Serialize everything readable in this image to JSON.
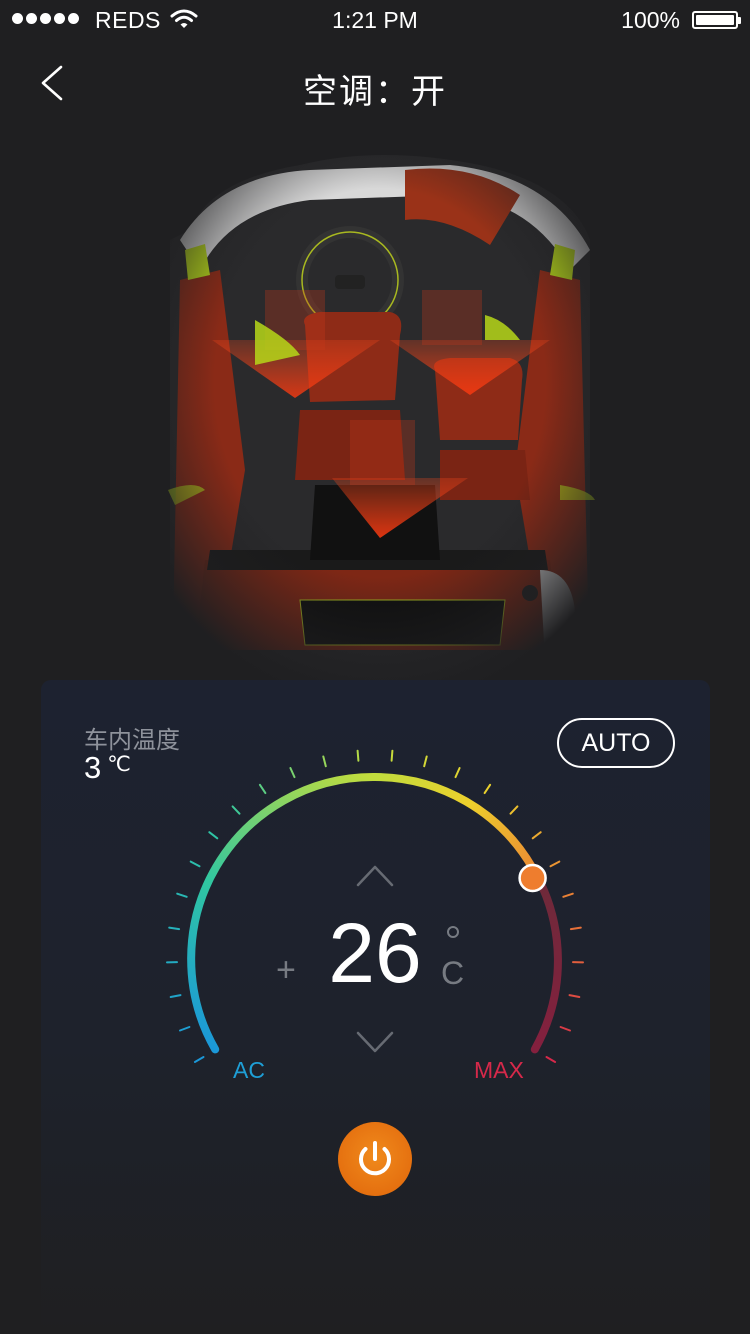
{
  "status_bar": {
    "carrier": "REDS",
    "time": "1:21 PM",
    "battery_percent": "100%"
  },
  "nav": {
    "title": "空调：开"
  },
  "panel": {
    "inner_temp_label": "车内温度",
    "inner_temp_value": "3",
    "inner_temp_unit": "℃",
    "auto_label": "AUTO",
    "target_temp": "26",
    "target_unit": "C",
    "plus_label": "+",
    "min_label": "AC",
    "max_label": "MAX"
  },
  "colors": {
    "background": "#1f1f21",
    "panel": "#1d2230",
    "power_button": "#e8730f",
    "ac_label": "#1e9fd6",
    "max_label": "#d6294a",
    "airflow": "#c9381a",
    "seat_leather": "#8a2a17",
    "accent_green": "#b6d719"
  },
  "icons": {
    "back": "chevron-left-icon",
    "up": "chevron-up-icon",
    "down": "chevron-down-icon",
    "power": "power-icon",
    "wifi": "wifi-icon",
    "battery": "battery-icon",
    "signal": "signal-dots-icon"
  }
}
